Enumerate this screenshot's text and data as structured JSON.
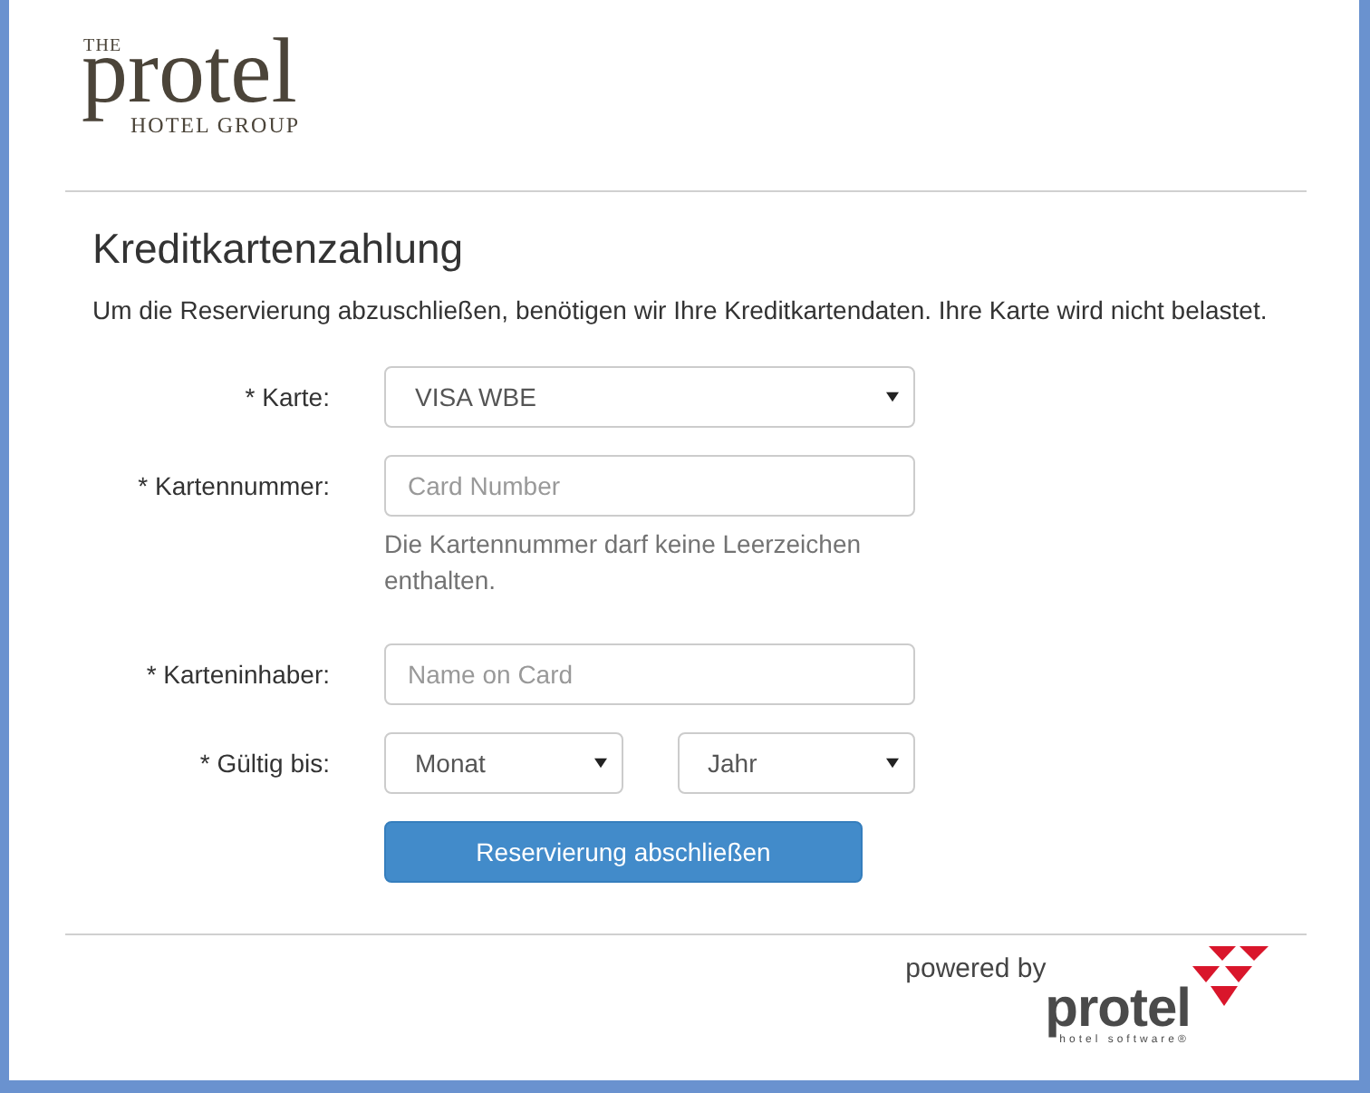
{
  "logo": {
    "prefix": "THE",
    "name": "protel",
    "subtitle": "HOTEL GROUP"
  },
  "title": "Kreditkartenzahlung",
  "intro": "Um die Reservierung abzuschließen, benötigen wir Ihre Kreditkartendaten. Ihre Karte wird nicht belastet.",
  "fields": [
    {
      "kind": "select",
      "label": "* Karte:",
      "value": "VISA WBE"
    },
    {
      "kind": "text",
      "label": "* Kartennummer:",
      "placeholder": "Card Number",
      "help": "Die Kartennummer darf keine Leerzeichen enthalten."
    },
    {
      "kind": "text",
      "label": "* Karteninhaber:",
      "placeholder": "Name on Card"
    },
    {
      "kind": "select_pair",
      "label": "* Gültig bis:",
      "selects": [
        {
          "value": "Monat"
        },
        {
          "value": "Jahr"
        }
      ]
    }
  ],
  "submit_button": "Reservierung abschließen",
  "footer": {
    "powered_by": "powered by",
    "brand": {
      "name": "protel",
      "tagline": "hotel software®"
    }
  }
}
